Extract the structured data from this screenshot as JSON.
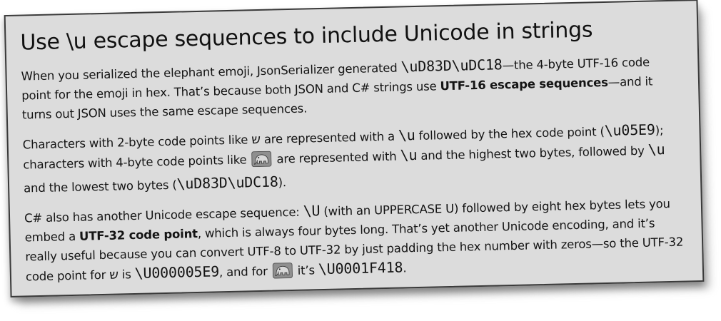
{
  "title": "Use \\u escape sequences to include Unicode in strings",
  "p1": {
    "t1": "When you serialized the elephant emoji, JsonSerializer generated ",
    "code1": "\\uD83D\\uDC18",
    "t2": "—the 4-byte UTF-16 code point for the emoji in hex. That’s because both JSON and C# strings use ",
    "bold1": "UTF-16 escape sequences",
    "t3": "—and it turns out JSON uses the same escape sequences."
  },
  "p2": {
    "t1": "Characters with 2-byte code points like ",
    "glyph1": "ש",
    "t2": " are represented with a ",
    "code1": "\\u",
    "t3": " followed by the hex code point (",
    "code2": "\\u05E9",
    "t4": "); characters with 4-byte code points like ",
    "t5": " are represented with ",
    "code3": "\\u",
    "t6": " and the highest two bytes, followed by ",
    "code4": "\\u",
    "t7": " and the lowest two bytes (",
    "code5": "\\uD83D\\uDC18",
    "t8": ")."
  },
  "p3": {
    "t1": "C# also has another Unicode escape sequence: ",
    "code1": "\\U",
    "t2": " (with an UPPERCASE U) followed by eight hex bytes lets you embed a ",
    "bold1": "UTF-32 code point",
    "t3": ", which is always four bytes long. That’s yet another Unicode encoding, and it’s really useful because you can  convert UTF-8 to UTF-32 by just padding the hex number with zeros—so the UTF-32 code point for ",
    "glyph1": "ש",
    "t4": " is ",
    "code2": "\\U000005E9",
    "t5": ", and for ",
    "t6": " it’s ",
    "code3": "\\U0001F418",
    "t7": "."
  },
  "icons": {
    "elephant": "elephant-emoji-icon"
  },
  "colors": {
    "card_background": "#dcdcdc",
    "text": "#141414"
  }
}
